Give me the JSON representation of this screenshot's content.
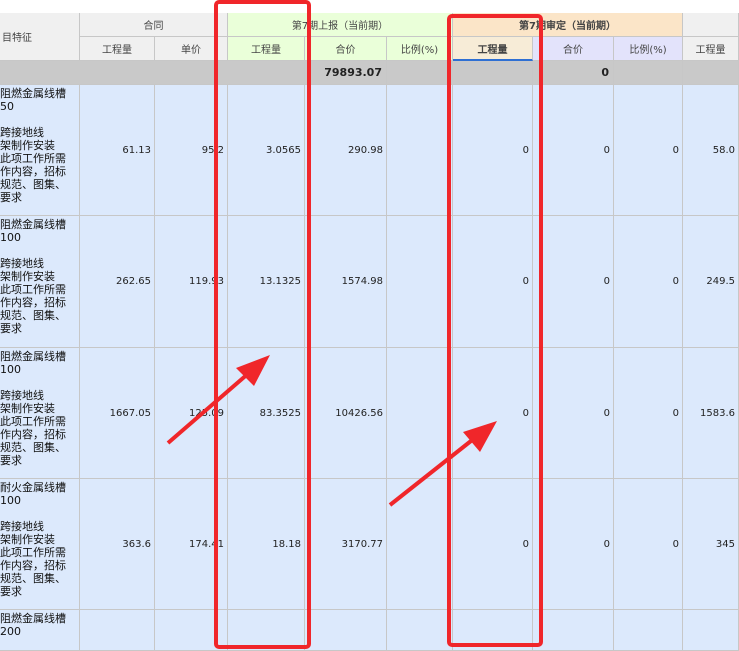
{
  "columns": {
    "item_feature": "目特征",
    "contract": {
      "title": "合同",
      "qty": "工程量",
      "price": "单价"
    },
    "report": {
      "title": "第7期上报（当前期）",
      "qty": "工程量",
      "amount": "合价",
      "ratio": "比例(%)"
    },
    "review": {
      "title": "第7期审定（当前期）",
      "qty": "工程量",
      "amount": "合价",
      "ratio": "比例(%)"
    },
    "next": {
      "qty": "工程量"
    }
  },
  "summary": {
    "report_amount": "79893.07",
    "review_amount": "0"
  },
  "rows": [
    {
      "desc": [
        "阻燃金属线槽",
        "50",
        "",
        "跨接地线",
        "架制作安装",
        "此项工作所需",
        "作内容，招标",
        "规范、图集、",
        "要求"
      ],
      "contract_qty": "61.13",
      "contract_price": "95.2",
      "report_qty": "3.0565",
      "report_amount": "290.98",
      "report_ratio": "",
      "review_qty": "0",
      "review_amount": "0",
      "review_ratio": "0",
      "next_qty": "58.0"
    },
    {
      "desc": [
        "阻燃金属线槽",
        "100",
        "",
        "跨接地线",
        "架制作安装",
        "此项工作所需",
        "作内容，招标",
        "规范、图集、",
        "要求"
      ],
      "contract_qty": "262.65",
      "contract_price": "119.93",
      "report_qty": "13.1325",
      "report_amount": "1574.98",
      "report_ratio": "",
      "review_qty": "0",
      "review_amount": "0",
      "review_ratio": "0",
      "next_qty": "249.5"
    },
    {
      "desc": [
        "阻燃金属线槽",
        "100",
        "",
        "跨接地线",
        "架制作安装",
        "此项工作所需",
        "作内容，招标",
        "规范、图集、",
        "要求"
      ],
      "contract_qty": "1667.05",
      "contract_price": "125.09",
      "report_qty": "83.3525",
      "report_amount": "10426.56",
      "report_ratio": "",
      "review_qty": "0",
      "review_amount": "0",
      "review_ratio": "0",
      "next_qty": "1583.6"
    },
    {
      "desc": [
        "耐火金属线槽",
        "100",
        "",
        "跨接地线",
        "架制作安装",
        "此项工作所需",
        "作内容，招标",
        "规范、图集、",
        "要求"
      ],
      "contract_qty": "363.6",
      "contract_price": "174.41",
      "report_qty": "18.18",
      "report_amount": "3170.77",
      "report_ratio": "",
      "review_qty": "0",
      "review_amount": "0",
      "review_ratio": "0",
      "next_qty": "345"
    },
    {
      "desc": [
        "阻燃金属线槽",
        "200"
      ],
      "contract_qty": "",
      "contract_price": "",
      "report_qty": "",
      "report_amount": "",
      "report_ratio": "",
      "review_qty": "",
      "review_amount": "",
      "review_ratio": "",
      "next_qty": ""
    }
  ],
  "annotation_color": "#f0262a"
}
